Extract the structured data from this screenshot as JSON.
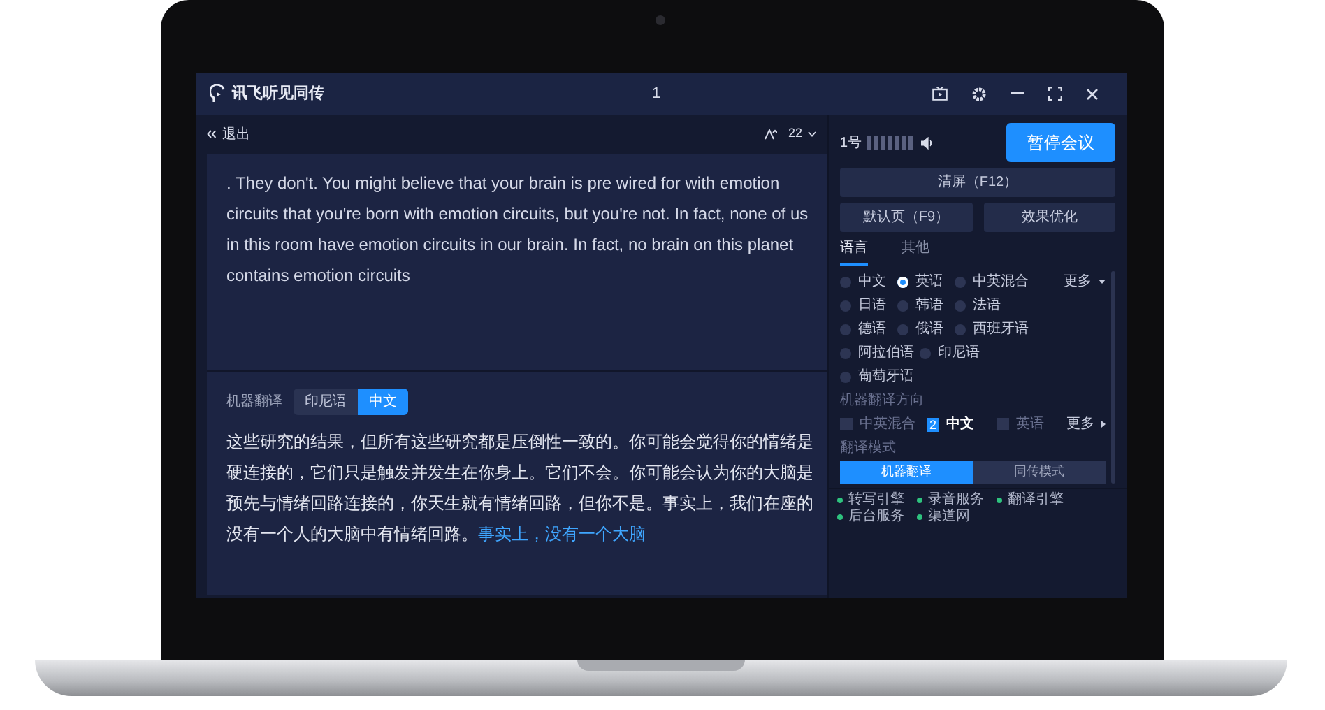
{
  "title_bar": {
    "app_name": "讯飞听见同传",
    "meeting_number": "1"
  },
  "left_panel": {
    "back_label": "退出",
    "font_size": "22",
    "source_text": ". They don't. You might believe that your brain is pre wired for with emotion circuits that you're born with emotion circuits, but you're not. In fact, none of us in this room have emotion circuits in our brain. In fact, no brain on this planet contains emotion circuits",
    "translation": {
      "label": "机器翻译",
      "toggles": [
        {
          "label": "印尼语",
          "selected": false
        },
        {
          "label": "中文",
          "selected": true
        }
      ],
      "text": "这些研究的结果，但所有这些研究都是压倒性一致的。你可能会觉得你的情绪是硬连接的，它们只是触发并发生在你身上。它们不会。你可能会认为你的大脑是预先与情绪回路连接的，你天生就有情绪回路，但你不是。事实上，我们在座的没有一个人的大脑中有情绪回路。",
      "pending_text": "事实上，没有一个大脑"
    }
  },
  "right_panel": {
    "speaker": "1号",
    "pause_button": "暂停会议",
    "clear_button": "清屏（F12）",
    "default_button": "默认页（F9）",
    "optimize_button": "效果优化",
    "tabs": [
      {
        "label": "语言",
        "selected": true
      },
      {
        "label": "其他",
        "selected": false
      }
    ],
    "language_rows": [
      [
        {
          "label": "中文",
          "selected": false
        },
        {
          "label": "英语",
          "selected": true
        },
        {
          "label": "中英混合",
          "selected": false
        }
      ],
      [
        {
          "label": "日语",
          "selected": false
        },
        {
          "label": "韩语",
          "selected": false
        },
        {
          "label": "法语",
          "selected": false
        }
      ],
      [
        {
          "label": "德语",
          "selected": false
        },
        {
          "label": "俄语",
          "selected": false
        },
        {
          "label": "西班牙语",
          "selected": false
        }
      ],
      [
        {
          "label": "阿拉伯语",
          "selected": false
        },
        {
          "label": "印尼语",
          "selected": false
        }
      ],
      [
        {
          "label": "葡萄牙语",
          "selected": false
        }
      ]
    ],
    "language_more": "更多",
    "direction_label": "机器翻译方向",
    "directions": [
      {
        "label": "中英混合",
        "disabled": true,
        "selected": false
      },
      {
        "label": "中文",
        "disabled": false,
        "selected": true,
        "badge": "2"
      },
      {
        "label": "英语",
        "disabled": true,
        "selected": false
      }
    ],
    "direction_more": "更多",
    "mode_label": "翻译模式",
    "modes": [
      {
        "label": "机器翻译",
        "selected": true
      },
      {
        "label": "同传模式",
        "selected": false
      }
    ],
    "status_items": [
      {
        "label": "转写引擎",
        "color": "#2ec27e"
      },
      {
        "label": "录音服务",
        "color": "#2ec27e"
      },
      {
        "label": "翻译引擎",
        "color": "#2ec27e"
      },
      {
        "label": "后台服务",
        "color": "#2ec27e"
      },
      {
        "label": "渠道网",
        "color": "#2ec27e"
      }
    ]
  }
}
